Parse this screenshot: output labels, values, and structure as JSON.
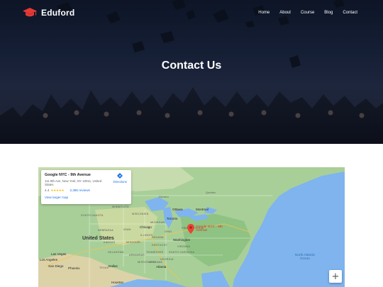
{
  "brand": {
    "name": "Eduford",
    "logo_icon": "graduation-cap-icon"
  },
  "nav": [
    {
      "label": "Home"
    },
    {
      "label": "About"
    },
    {
      "label": "Course"
    },
    {
      "label": "Blog"
    },
    {
      "label": "Contact"
    }
  ],
  "hero": {
    "title": "Contact Us"
  },
  "map": {
    "place": {
      "name": "Google NYC - 9th Avenue",
      "address": "111 8th Ave, New York, NY 10011, United States",
      "rating": "4.4",
      "stars": "★★★★★",
      "reviews": "2,386 reviews",
      "larger_map": "View larger map",
      "directions": "Directions"
    },
    "pin_label": "Google NYC - 9th Avenue",
    "labels": {
      "country": "United States",
      "ocean": "North Atlantic Ocean",
      "saskatchewan": "Saskatchewan",
      "ontario": "Ontario",
      "quebec": "Quebec",
      "nebraska": "NEBRASKA",
      "kansas": "KANSAS",
      "oklahoma": "OKLAHOMA",
      "texas": "TEXAS",
      "missouri": "MISSOURI",
      "iowa": "IOWA",
      "illinois": "ILLINOIS",
      "indiana": "INDIANA",
      "ohio": "OHIO",
      "kentucky": "KENTUCKY",
      "tennessee": "TENNESSEE",
      "arkansas": "ARKANSAS",
      "mississippi": "MISSISSIPPI",
      "alabama": "ALABAMA",
      "georgia": "GEORGIA",
      "carolina": "SOUTH CAROLINA",
      "virginia": "VIRGINIA",
      "pennsylvania": "PENNSYLVANIA",
      "michigan": "MICHIGAN",
      "wisconsin": "WISCONSIN",
      "minnesota": "MINNESOTA",
      "dakota": "SOUTH DAKOTA",
      "ottawa": "Ottawa",
      "montreal": "Montreal",
      "toronto": "Toronto",
      "chicago": "Chicago",
      "washington": "Washington",
      "las_vegas": "Las Vegas",
      "los_angeles": "Los Angeles",
      "san_diego": "San Diego",
      "phoenix": "Phoenix",
      "dallas": "Dallas",
      "houston": "Houston",
      "atlanta": "Atlanta"
    },
    "zoom_in": "+"
  }
}
